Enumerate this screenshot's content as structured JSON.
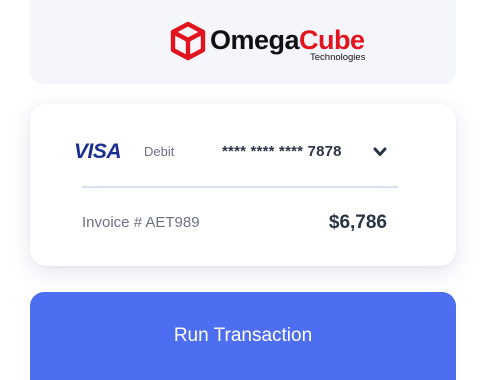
{
  "brand": {
    "name_part1": "Omega",
    "name_part2": "Cube",
    "tagline": "Technologies",
    "icon": "cube-logo-icon",
    "colors": {
      "omega": "#111111",
      "cube": "#e1141e"
    }
  },
  "payment": {
    "card_brand": "VISA",
    "card_type": "Debit",
    "card_number": "**** **** **** 7878",
    "dropdown_icon": "chevron-down-icon",
    "invoice_label": "Invoice # AET989",
    "amount": "$6,786"
  },
  "action": {
    "run_label": "Run Transaction",
    "color": "#4e6ef2"
  }
}
